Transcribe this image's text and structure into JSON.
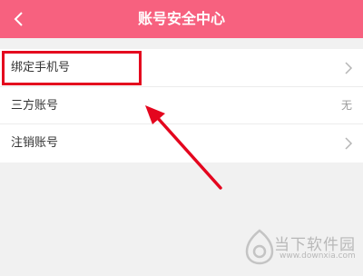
{
  "header": {
    "title": "账号安全中心",
    "back_icon": "chevron-left-icon"
  },
  "settings": {
    "items": [
      {
        "label": "绑定手机号",
        "value": "",
        "icon": "chevron-right-icon"
      },
      {
        "label": "三方账号",
        "value": "无"
      },
      {
        "label": "注销账号",
        "value": "",
        "icon": "chevron-right-icon"
      }
    ]
  },
  "watermark": {
    "text": "当下软件园",
    "url": "www.downxia.com"
  },
  "colors": {
    "header": "#f7617f",
    "highlight": "#e4061e",
    "background": "#f1f1f1"
  }
}
